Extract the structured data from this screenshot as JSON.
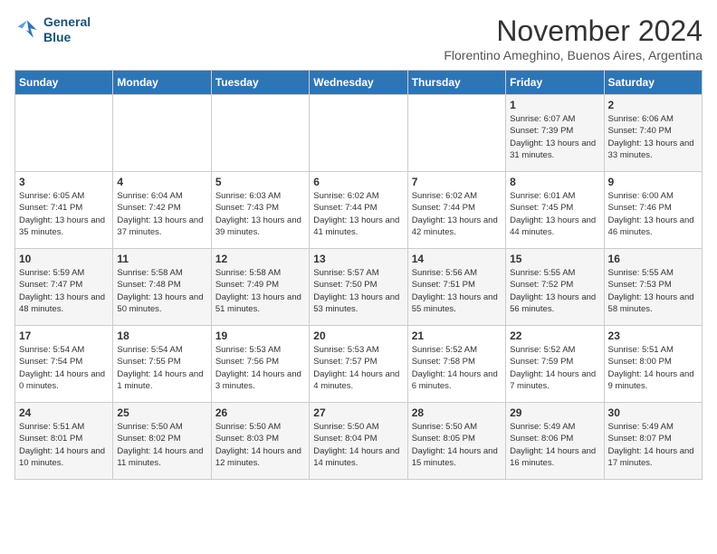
{
  "logo": {
    "line1": "General",
    "line2": "Blue"
  },
  "title": "November 2024",
  "location": "Florentino Ameghino, Buenos Aires, Argentina",
  "days_of_week": [
    "Sunday",
    "Monday",
    "Tuesday",
    "Wednesday",
    "Thursday",
    "Friday",
    "Saturday"
  ],
  "weeks": [
    [
      {
        "day": "",
        "info": ""
      },
      {
        "day": "",
        "info": ""
      },
      {
        "day": "",
        "info": ""
      },
      {
        "day": "",
        "info": ""
      },
      {
        "day": "",
        "info": ""
      },
      {
        "day": "1",
        "info": "Sunrise: 6:07 AM\nSunset: 7:39 PM\nDaylight: 13 hours and 31 minutes."
      },
      {
        "day": "2",
        "info": "Sunrise: 6:06 AM\nSunset: 7:40 PM\nDaylight: 13 hours and 33 minutes."
      }
    ],
    [
      {
        "day": "3",
        "info": "Sunrise: 6:05 AM\nSunset: 7:41 PM\nDaylight: 13 hours and 35 minutes."
      },
      {
        "day": "4",
        "info": "Sunrise: 6:04 AM\nSunset: 7:42 PM\nDaylight: 13 hours and 37 minutes."
      },
      {
        "day": "5",
        "info": "Sunrise: 6:03 AM\nSunset: 7:43 PM\nDaylight: 13 hours and 39 minutes."
      },
      {
        "day": "6",
        "info": "Sunrise: 6:02 AM\nSunset: 7:44 PM\nDaylight: 13 hours and 41 minutes."
      },
      {
        "day": "7",
        "info": "Sunrise: 6:02 AM\nSunset: 7:44 PM\nDaylight: 13 hours and 42 minutes."
      },
      {
        "day": "8",
        "info": "Sunrise: 6:01 AM\nSunset: 7:45 PM\nDaylight: 13 hours and 44 minutes."
      },
      {
        "day": "9",
        "info": "Sunrise: 6:00 AM\nSunset: 7:46 PM\nDaylight: 13 hours and 46 minutes."
      }
    ],
    [
      {
        "day": "10",
        "info": "Sunrise: 5:59 AM\nSunset: 7:47 PM\nDaylight: 13 hours and 48 minutes."
      },
      {
        "day": "11",
        "info": "Sunrise: 5:58 AM\nSunset: 7:48 PM\nDaylight: 13 hours and 50 minutes."
      },
      {
        "day": "12",
        "info": "Sunrise: 5:58 AM\nSunset: 7:49 PM\nDaylight: 13 hours and 51 minutes."
      },
      {
        "day": "13",
        "info": "Sunrise: 5:57 AM\nSunset: 7:50 PM\nDaylight: 13 hours and 53 minutes."
      },
      {
        "day": "14",
        "info": "Sunrise: 5:56 AM\nSunset: 7:51 PM\nDaylight: 13 hours and 55 minutes."
      },
      {
        "day": "15",
        "info": "Sunrise: 5:55 AM\nSunset: 7:52 PM\nDaylight: 13 hours and 56 minutes."
      },
      {
        "day": "16",
        "info": "Sunrise: 5:55 AM\nSunset: 7:53 PM\nDaylight: 13 hours and 58 minutes."
      }
    ],
    [
      {
        "day": "17",
        "info": "Sunrise: 5:54 AM\nSunset: 7:54 PM\nDaylight: 14 hours and 0 minutes."
      },
      {
        "day": "18",
        "info": "Sunrise: 5:54 AM\nSunset: 7:55 PM\nDaylight: 14 hours and 1 minute."
      },
      {
        "day": "19",
        "info": "Sunrise: 5:53 AM\nSunset: 7:56 PM\nDaylight: 14 hours and 3 minutes."
      },
      {
        "day": "20",
        "info": "Sunrise: 5:53 AM\nSunset: 7:57 PM\nDaylight: 14 hours and 4 minutes."
      },
      {
        "day": "21",
        "info": "Sunrise: 5:52 AM\nSunset: 7:58 PM\nDaylight: 14 hours and 6 minutes."
      },
      {
        "day": "22",
        "info": "Sunrise: 5:52 AM\nSunset: 7:59 PM\nDaylight: 14 hours and 7 minutes."
      },
      {
        "day": "23",
        "info": "Sunrise: 5:51 AM\nSunset: 8:00 PM\nDaylight: 14 hours and 9 minutes."
      }
    ],
    [
      {
        "day": "24",
        "info": "Sunrise: 5:51 AM\nSunset: 8:01 PM\nDaylight: 14 hours and 10 minutes."
      },
      {
        "day": "25",
        "info": "Sunrise: 5:50 AM\nSunset: 8:02 PM\nDaylight: 14 hours and 11 minutes."
      },
      {
        "day": "26",
        "info": "Sunrise: 5:50 AM\nSunset: 8:03 PM\nDaylight: 14 hours and 12 minutes."
      },
      {
        "day": "27",
        "info": "Sunrise: 5:50 AM\nSunset: 8:04 PM\nDaylight: 14 hours and 14 minutes."
      },
      {
        "day": "28",
        "info": "Sunrise: 5:50 AM\nSunset: 8:05 PM\nDaylight: 14 hours and 15 minutes."
      },
      {
        "day": "29",
        "info": "Sunrise: 5:49 AM\nSunset: 8:06 PM\nDaylight: 14 hours and 16 minutes."
      },
      {
        "day": "30",
        "info": "Sunrise: 5:49 AM\nSunset: 8:07 PM\nDaylight: 14 hours and 17 minutes."
      }
    ]
  ]
}
